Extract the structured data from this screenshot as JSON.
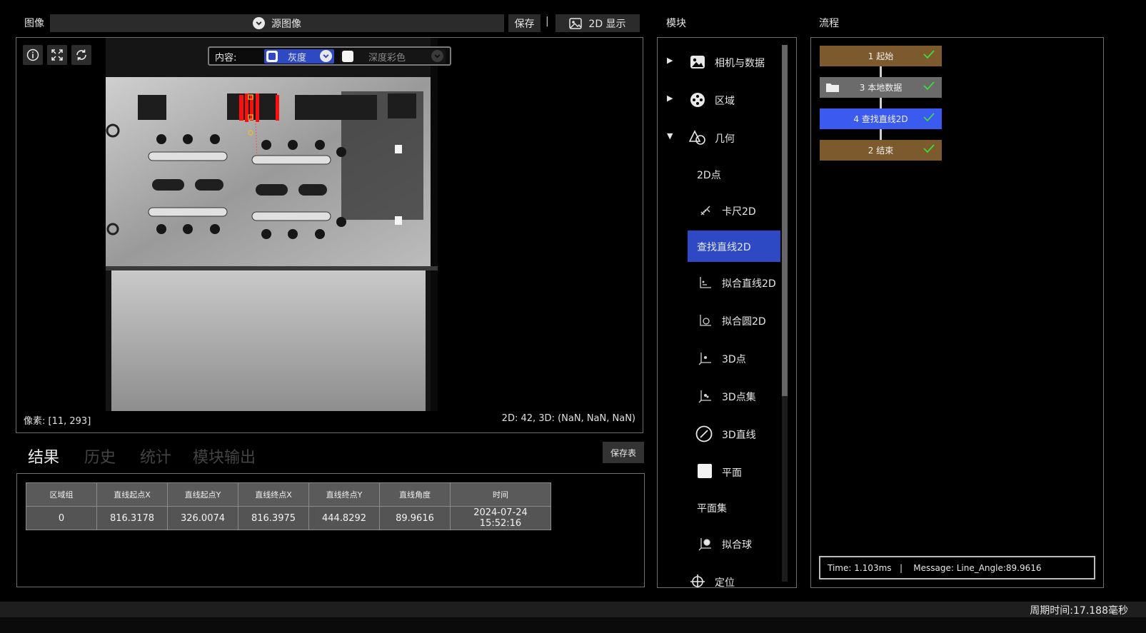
{
  "image_panel": {
    "title": "图像",
    "source_label": "源图像",
    "save_label": "保存",
    "separator": "|",
    "display_label": "2D 显示",
    "content_label": "内容:",
    "gray_label": "灰度",
    "depth_label": "深度彩色",
    "pixel_readout": "像素: [11, 293]",
    "value_readout": "2D: 42, 3D: (NaN, NaN, NaN)"
  },
  "result_panel": {
    "tabs": [
      {
        "label": "结果",
        "active": true
      },
      {
        "label": "历史",
        "active": false
      },
      {
        "label": "统计",
        "active": false
      },
      {
        "label": "模块输出",
        "active": false
      }
    ],
    "save_table_label": "保存表",
    "columns": [
      "区域组",
      "直线起点X",
      "直线起点Y",
      "直线终点X",
      "直线终点Y",
      "直线角度",
      "时间"
    ],
    "rows": [
      [
        "0",
        "816.3178",
        "326.0074",
        "816.3975",
        "444.8292",
        "89.9616",
        "2024-07-24 15:52:16"
      ]
    ]
  },
  "module_panel": {
    "title": "模块",
    "items": [
      {
        "label": "相机与数据",
        "icon": "camera-data-icon",
        "arrow": "▶"
      },
      {
        "label": "区域",
        "icon": "region-icon",
        "arrow": "▶"
      },
      {
        "label": "几何",
        "icon": "geometry-icon",
        "arrow": "▼"
      },
      {
        "label": "2D点"
      },
      {
        "label": "卡尺2D",
        "icon": "caliper-icon"
      },
      {
        "label": "查找直线2D",
        "selected": true
      },
      {
        "label": "拟合直线2D",
        "icon": "fit-line-icon"
      },
      {
        "label": "拟合圆2D",
        "icon": "fit-circle-icon"
      },
      {
        "label": "3D点",
        "icon": "point-3d-icon"
      },
      {
        "label": "3D点集",
        "icon": "point-set-3d-icon"
      },
      {
        "label": "3D直线",
        "icon": "line-3d-icon"
      },
      {
        "label": "平面",
        "icon": "plane-icon"
      },
      {
        "label": "平面集"
      },
      {
        "label": "拟合球",
        "icon": "fit-sphere-icon"
      },
      {
        "label": "定位",
        "icon": "locate-icon"
      }
    ]
  },
  "flow_panel": {
    "title": "流程",
    "nodes": [
      {
        "label": "1 起始",
        "color": "#7d5a2e"
      },
      {
        "label": "3 本地数据",
        "color": "#6b6b6b",
        "icon": "folder-icon"
      },
      {
        "label": "4 查找直线2D",
        "color": "#3b5bf0"
      },
      {
        "label": "2 结束",
        "color": "#7d5a2e"
      }
    ],
    "status": "Time: 1.103ms   |    Message: Line_Angle:89.9616"
  },
  "status_bar": {
    "cycle_time": "周期时间:17.188毫秒"
  },
  "colors": {
    "accent_blue": "#3b5bf0",
    "selected_item": "#2e49c4",
    "start_end_node": "#7d5a2e",
    "check_green": "#3ddc3d"
  }
}
